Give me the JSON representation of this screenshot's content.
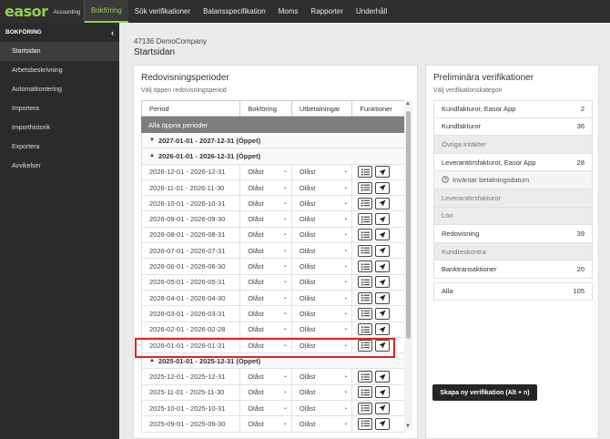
{
  "brand": {
    "name": "easor",
    "sub": "Accounting",
    "color": "#8fd14f"
  },
  "nav": [
    {
      "label": "Bokföring",
      "active": true
    },
    {
      "label": "Sök verifikationer"
    },
    {
      "label": "Balansspecifikation"
    },
    {
      "label": "Moms"
    },
    {
      "label": "Rapporter"
    },
    {
      "label": "Underhåll"
    }
  ],
  "sidebar": {
    "title": "BOKFÖRING",
    "items": [
      {
        "label": "Startsidan",
        "active": true
      },
      {
        "label": "Arbetsbeskrivning"
      },
      {
        "label": "Automatkontering"
      },
      {
        "label": "Importera"
      },
      {
        "label": "Importhistorik"
      },
      {
        "label": "Exportera"
      },
      {
        "label": "Avvikelser"
      }
    ]
  },
  "breadcrumb": "47136 DemoCompany",
  "page_title": "Startsidan",
  "periods_panel": {
    "title": "Redovisningsperioder",
    "subtitle": "Välj öppen redovisningsperiod",
    "columns": [
      "Period",
      "Bokföring",
      "Utbetalningar",
      "Funktioner"
    ],
    "all_open": "Alla öppna perioder",
    "select_value": "Olåst",
    "years": [
      {
        "label": "2027-01-01 - 2027-12-31 (Öppet)",
        "expanded": false,
        "periods": []
      },
      {
        "label": "2026-01-01 - 2026-12-31 (Öppet)",
        "expanded": true,
        "periods": [
          "2026-12-01 - 2026-12-31",
          "2026-11-01 - 2026-11-30",
          "2026-10-01 - 2026-10-31",
          "2026-09-01 - 2026-09-30",
          "2026-08-01 - 2026-08-31",
          "2026-07-01 - 2026-07-31",
          "2026-06-01 - 2026-06-30",
          "2026-05-01 - 2026-05-31",
          "2026-04-01 - 2026-04-30",
          "2026-03-01 - 2026-03-31",
          "2026-02-01 - 2026-02-28",
          "2026-01-01 - 2026-01-31"
        ]
      },
      {
        "label": "2025-01-01 - 2025-12-31 (Öppet)",
        "expanded": true,
        "periods": [
          "2025-12-01 - 2025-12-31",
          "2025-11-01 - 2025-11-30",
          "2025-10-01 - 2025-10-31",
          "2025-09-01 - 2025-09-30"
        ]
      }
    ],
    "highlighted_period": "2026-01-01 - 2026-01-31",
    "highlight_color": "#e0221e"
  },
  "prelim_panel": {
    "title": "Preliminära verifikationer",
    "subtitle": "Välj verifikationskategori",
    "categories": [
      {
        "label": "Kundfakturor, Easor App",
        "count": "2",
        "kind": "item"
      },
      {
        "label": "Kundfakturor",
        "count": "36",
        "kind": "item"
      },
      {
        "label": "Övriga intäkter",
        "count": "",
        "kind": "head"
      },
      {
        "label": "Leverantörsfakturor, Easor App",
        "count": "28",
        "kind": "item"
      },
      {
        "label": "Inväntar betalningsdatum",
        "count": "",
        "kind": "sub"
      },
      {
        "label": "Leverantörsfakturor",
        "count": "",
        "kind": "head"
      },
      {
        "label": "Lön",
        "count": "",
        "kind": "head"
      },
      {
        "label": "Redovisning",
        "count": "39",
        "kind": "item"
      },
      {
        "label": "Kundreskontra",
        "count": "",
        "kind": "head"
      },
      {
        "label": "Banktransaktioner",
        "count": "20",
        "kind": "item"
      }
    ],
    "all": {
      "label": "Alla",
      "count": "105"
    },
    "create_button": "Skapa ny verifikation (Alt + n)"
  }
}
